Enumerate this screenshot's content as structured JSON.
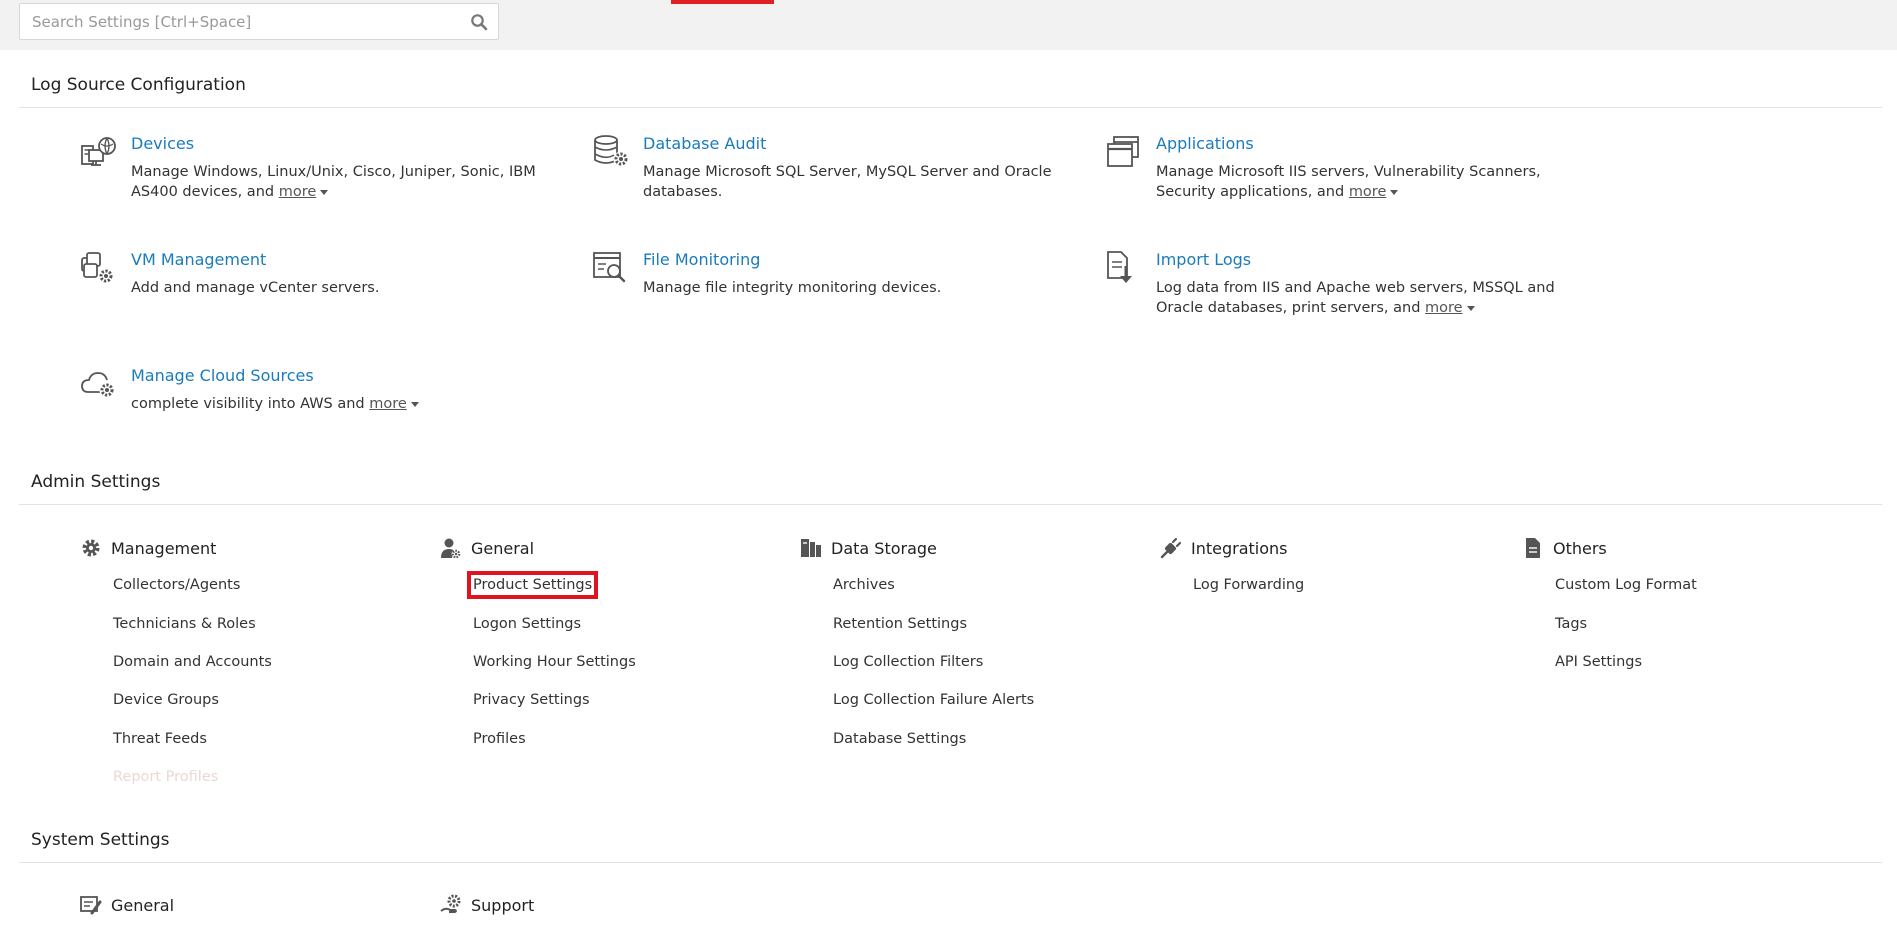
{
  "search": {
    "placeholder": "Search Settings [Ctrl+Space]",
    "icon": "search-icon"
  },
  "colors": {
    "link": "#1a7bbd",
    "accent": "#e02020",
    "highlight_border": "#e0141e"
  },
  "log_source": {
    "title": "Log Source Configuration",
    "items": [
      {
        "title": "Devices",
        "desc": "Manage Windows, Linux/Unix, Cisco, Juniper, Sonic, IBM AS400 devices, and",
        "more": "more",
        "icon": "devices-icon"
      },
      {
        "title": "Database Audit",
        "desc": "Manage Microsoft SQL Server, MySQL Server and Oracle databases.",
        "more": "",
        "icon": "database-audit-icon"
      },
      {
        "title": "Applications",
        "desc": "Manage Microsoft IIS servers, Vulnerability Scanners, Security applications, and",
        "more": "more",
        "icon": "applications-icon"
      },
      {
        "title": "VM Management",
        "desc": "Add and manage vCenter servers.",
        "more": "",
        "icon": "vm-management-icon"
      },
      {
        "title": "File Monitoring",
        "desc": "Manage file integrity monitoring devices.",
        "more": "",
        "icon": "file-monitoring-icon"
      },
      {
        "title": "Import Logs",
        "desc": "Log data from IIS and Apache web servers, MSSQL and Oracle databases, print servers, and",
        "more": "more",
        "icon": "import-logs-icon"
      },
      {
        "title": "Manage Cloud Sources",
        "desc": "complete visibility into AWS and",
        "more": "more",
        "icon": "cloud-sources-icon"
      }
    ]
  },
  "admin": {
    "title": "Admin Settings",
    "groups": [
      {
        "label": "Management",
        "icon": "gear-icon",
        "items": [
          "Collectors/Agents",
          "Technicians & Roles",
          "Domain and Accounts",
          "Device Groups",
          "Threat Feeds",
          "Report Profiles"
        ]
      },
      {
        "label": "General",
        "icon": "user-settings-icon",
        "items": [
          "Product Settings",
          "Logon Settings",
          "Working Hour Settings",
          "Privacy Settings",
          "Profiles"
        ]
      },
      {
        "label": "Data Storage",
        "icon": "data-storage-icon",
        "items": [
          "Archives",
          "Retention Settings",
          "Log Collection Filters",
          "Log Collection Failure Alerts",
          "Database Settings"
        ]
      },
      {
        "label": "Integrations",
        "icon": "plug-icon",
        "items": [
          "Log Forwarding"
        ]
      },
      {
        "label": "Others",
        "icon": "document-icon",
        "items": [
          "Custom Log Format",
          "Tags",
          "API Settings"
        ]
      }
    ]
  },
  "system": {
    "title": "System Settings",
    "groups": [
      {
        "label": "General",
        "icon": "system-general-icon"
      },
      {
        "label": "Support",
        "icon": "support-icon"
      }
    ]
  }
}
